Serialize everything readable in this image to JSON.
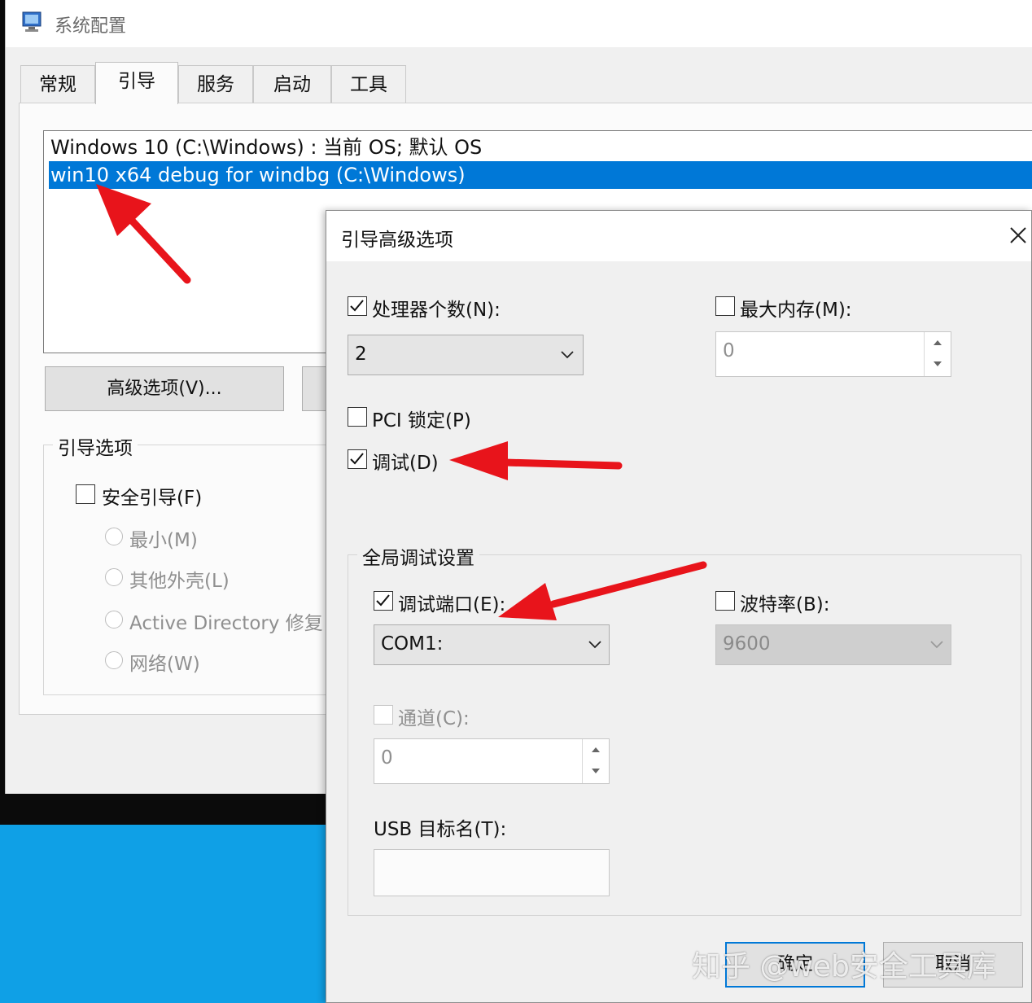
{
  "window": {
    "title": "系统配置"
  },
  "tabs": [
    {
      "label": "常规"
    },
    {
      "label": "引导"
    },
    {
      "label": "服务"
    },
    {
      "label": "启动"
    },
    {
      "label": "工具"
    }
  ],
  "os_list": [
    {
      "text": "Windows 10 (C:\\Windows) : 当前 OS; 默认 OS",
      "selected": false
    },
    {
      "text": "win10 x64 debug for windbg (C:\\Windows)",
      "selected": true
    }
  ],
  "buttons": {
    "advanced": "高级选项(V)..."
  },
  "boot_options": {
    "title": "引导选项",
    "safe_boot": "安全引导(F)",
    "radios": [
      "最小(M)",
      "其他外壳(L)",
      "Active Directory 修复",
      "网络(W)"
    ]
  },
  "dialog": {
    "title": "引导高级选项",
    "num_proc_label": "处理器个数(N):",
    "num_proc_value": "2",
    "max_mem_label": "最大内存(M):",
    "max_mem_value": "0",
    "pci_lock_label": "PCI 锁定(P)",
    "debug_label": "调试(D)",
    "global_debug_title": "全局调试设置",
    "debug_port_label": "调试端口(E):",
    "debug_port_value": "COM1:",
    "baud_label": "波特率(B):",
    "baud_value": "9600",
    "channel_label": "通道(C):",
    "channel_value": "0",
    "usb_label": "USB 目标名(T):",
    "ok_label": "确定",
    "cancel_label": "取消"
  },
  "watermark": "知乎 @web安全工具库",
  "colors": {
    "selection": "#0078d7",
    "arrow": "#e8141b",
    "desktop": "#0fa0e6"
  }
}
